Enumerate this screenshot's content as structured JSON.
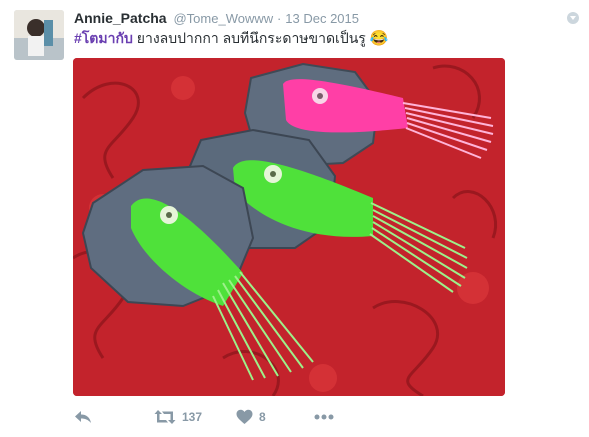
{
  "tweet": {
    "display_name": "Annie_Patcha",
    "handle": "@Tome_Wowww",
    "separator": "·",
    "date": "13 Dec 2015",
    "hashtag": "#โตมากับ",
    "text": " ยางลบปากกา ลบทีนึกระดาษขาดเป็นรู ",
    "emoji": "😂",
    "media": {
      "icon": "photo-eraser-brushes",
      "colors": {
        "background": "#c3232c",
        "eraser_gray": "#5f6d7f",
        "pink": "#ff3fa6",
        "green": "#4fe13a"
      }
    }
  },
  "actions": {
    "reply_icon": "reply-icon",
    "retweet_icon": "retweet-icon",
    "retweet_count": "137",
    "like_icon": "heart-icon",
    "like_count": "8",
    "more_icon": "more-icon"
  },
  "colors": {
    "accent": "#6a3fb1",
    "muted": "#8899a6",
    "text": "#292f33"
  }
}
